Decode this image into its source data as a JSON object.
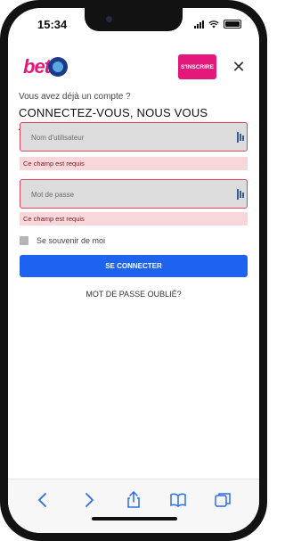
{
  "status": {
    "time": "15:34"
  },
  "header": {
    "logo_text": "bet",
    "signup_label": "S'INSCRIRE",
    "close_symbol": "✕"
  },
  "login": {
    "subtitle": "Vous avez déjà un compte ?",
    "title": "CONNECTEZ-VOUS, NOUS VOUS ATTENDONS",
    "username_placeholder": "Nom d'utilisateur",
    "username_error": "Ce champ est requis",
    "password_placeholder": "Mot de passe",
    "password_error": "Ce champ est requis",
    "remember_label": "Se souvenir de moi",
    "submit_label": "SE CONNECTER",
    "forgot_label": "MOT DE PASSE OUBLIÉ?"
  },
  "colors": {
    "brand": "#e3187a",
    "primary_button": "#1d63f0",
    "error_bg": "#f8d7da",
    "field_border": "#e0445a"
  },
  "bottom_bar": {
    "icons": [
      "back-icon",
      "forward-icon",
      "share-icon",
      "bookmarks-icon",
      "tabs-icon"
    ]
  }
}
